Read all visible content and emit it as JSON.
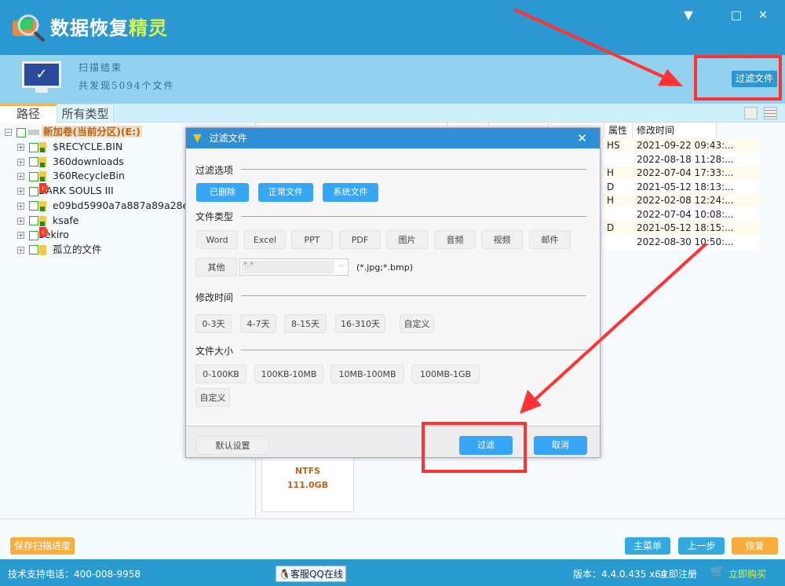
{
  "app": {
    "title_main": "数据恢复",
    "title_accent": "精灵"
  },
  "window_controls": [
    "▼",
    "□",
    "✕"
  ],
  "scan": {
    "status": "扫描结束",
    "found": "共发现5094个文件",
    "filter_button": "过滤文件"
  },
  "tabs": [
    {
      "label": "路径",
      "active": true
    },
    {
      "label": "所有类型",
      "active": false
    }
  ],
  "tree": {
    "root": "新加卷(当前分区)(E:)",
    "items": [
      {
        "label": "$RECYCLE.BIN",
        "icon": "folder-green"
      },
      {
        "label": "360downloads",
        "icon": "folder-green"
      },
      {
        "label": "360RecycleBin",
        "icon": "folder-green"
      },
      {
        "label": "DARK SOULS III",
        "icon": "folder-red"
      },
      {
        "label": "e09bd5990a7a887a89a28ebf982",
        "icon": "folder-green"
      },
      {
        "label": "ksafe",
        "icon": "folder-green"
      },
      {
        "label": "Sekiro",
        "icon": "folder-red"
      },
      {
        "label": "孤立的文件",
        "icon": "folder-question"
      }
    ]
  },
  "list": {
    "columns": [
      "属性",
      "修改时间"
    ],
    "rows": [
      {
        "attr": "HS",
        "time": "2021-09-22 09:43:..."
      },
      {
        "attr": "",
        "time": "2022-08-18 11:28:..."
      },
      {
        "attr": "H",
        "time": "2022-07-04 17:33:..."
      },
      {
        "attr": "D",
        "time": "2021-05-12 18:13:..."
      },
      {
        "attr": "H",
        "time": "2022-02-08 12:24:..."
      },
      {
        "attr": "",
        "time": "2022-07-04 10:08:..."
      },
      {
        "attr": "D",
        "time": "2021-05-12 18:15:..."
      },
      {
        "attr": "",
        "time": "2022-08-30 10:50:..."
      }
    ]
  },
  "partition": {
    "fs": "NTFS",
    "size": "111.0GB"
  },
  "dialog": {
    "title": "过滤文件",
    "sections": {
      "options": "过滤选项",
      "types": "文件类型",
      "mtime": "修改时间",
      "size": "文件大小"
    },
    "options": [
      "已删除",
      "正常文件",
      "系统文件"
    ],
    "types": [
      "Word",
      "Excel",
      "PPT",
      "PDF",
      "图片",
      "音频",
      "视频",
      "邮件"
    ],
    "other": "其他",
    "ext_value": "*.*",
    "ext_hint": "(*.jpg;*.bmp)",
    "mtimes": [
      "0-3天",
      "4-7天",
      "8-15天",
      "16-310天",
      "自定义"
    ],
    "sizes": [
      "0-100KB",
      "100KB-10MB",
      "10MB-100MB",
      "100MB-1GB"
    ],
    "size_custom": "自定义",
    "default": "默认设置",
    "ok": "过滤",
    "cancel": "取消"
  },
  "bottom": {
    "save": "保存扫描进度",
    "main_menu": "主菜单",
    "prev": "上一步",
    "recover": "恢复"
  },
  "status": {
    "phone": "技术支持电话：400-008-9958",
    "qq": "客服QQ在线",
    "version": "版本：4.4.0.435 x64",
    "register": "立即注册",
    "buy": "立即购买"
  },
  "colors": {
    "primary": "#2c98d2",
    "button_blue": "#36a6f5",
    "orange": "#f9ad3c",
    "annotation": "#ff3333"
  }
}
